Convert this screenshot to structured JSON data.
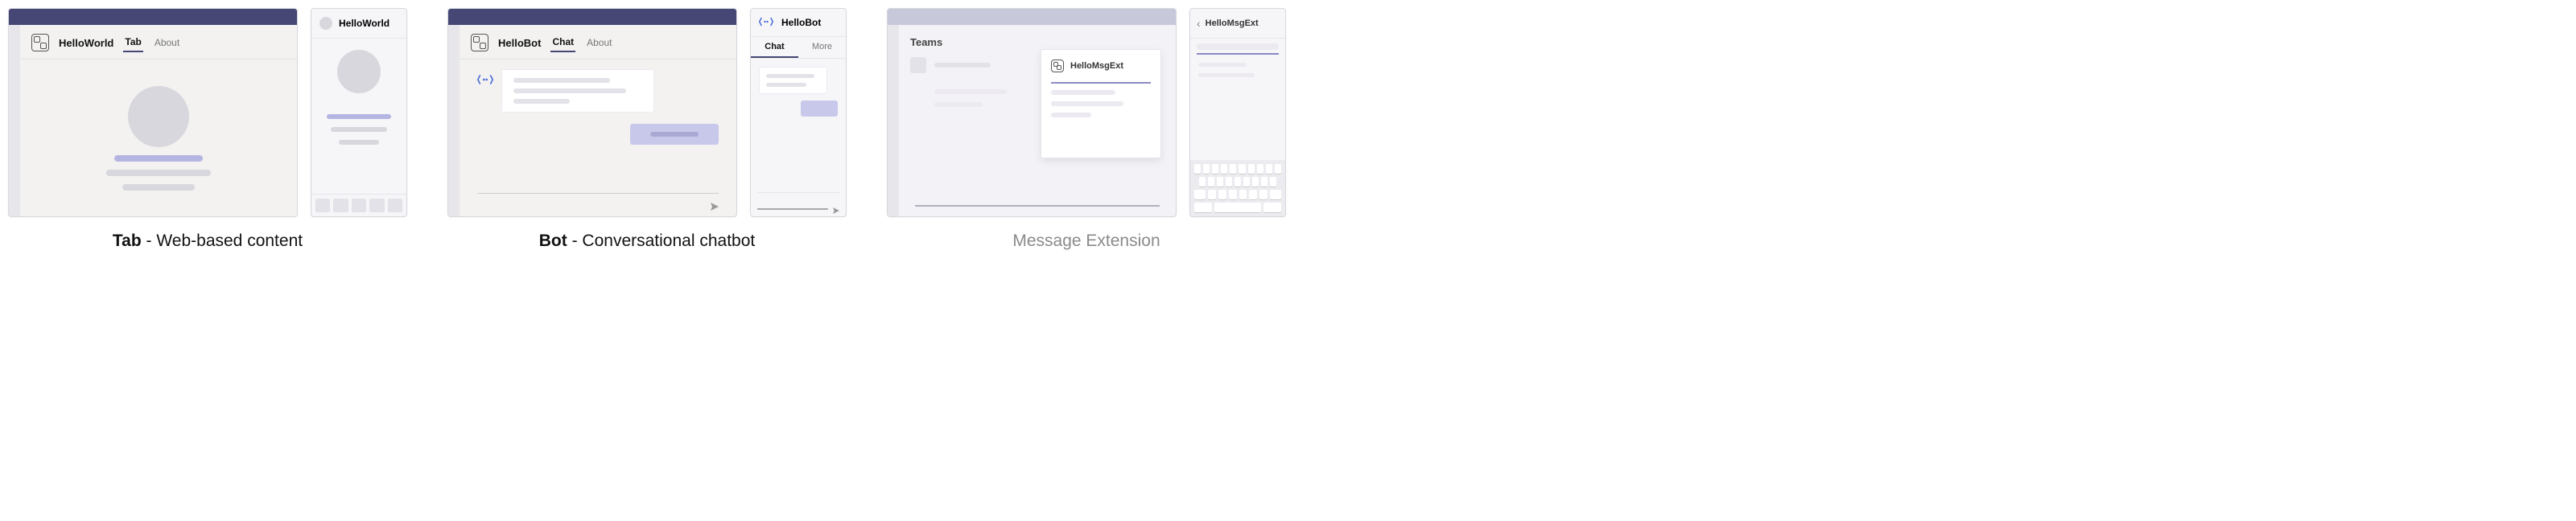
{
  "tab": {
    "desktop": {
      "title": "HelloWorld",
      "tab_active": "Tab",
      "tab_other": "About"
    },
    "mobile": {
      "title": "HelloWorld"
    },
    "caption_bold": "Tab",
    "caption_rest": " - Web-based content"
  },
  "bot": {
    "desktop": {
      "title": "HelloBot",
      "tab_active": "Chat",
      "tab_other": "About"
    },
    "mobile": {
      "title": "HelloBot",
      "tab_active": "Chat",
      "tab_other": "More"
    },
    "caption_bold": "Bot",
    "caption_rest": " - Conversational chatbot"
  },
  "msgext": {
    "desktop": {
      "sidebar_label": "Teams",
      "popup_title": "HelloMsgExt"
    },
    "mobile": {
      "title": "HelloMsgExt"
    },
    "caption": "Message Extension"
  }
}
